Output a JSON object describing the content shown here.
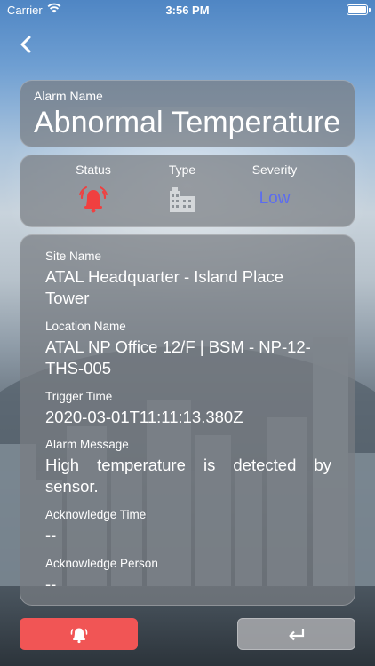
{
  "status_bar": {
    "carrier": "Carrier",
    "time": "3:56 PM"
  },
  "alarm_name": {
    "label": "Alarm Name",
    "value": "Abnormal Temperature"
  },
  "summary": {
    "status_label": "Status",
    "status_icon": "alarm-bell-icon",
    "type_label": "Type",
    "type_icon": "building-icon",
    "severity_label": "Severity",
    "severity_value": "Low",
    "severity_color": "#5b6cf0",
    "status_color": "#f04040"
  },
  "details": {
    "site_name_label": "Site Name",
    "site_name": "ATAL Headquarter - Island Place Tower",
    "location_label": "Location Name",
    "location": "ATAL NP Office 12/F | BSM - NP-12-THS-005",
    "trigger_time_label": "Trigger Time",
    "trigger_time": "2020-03-01T11:11:13.380Z",
    "message_label": "Alarm Message",
    "message": "High temperature is detected by sensor.",
    "ack_time_label": "Acknowledge Time",
    "ack_time": "--",
    "ack_person_label": "Acknowledge Person",
    "ack_person": "--"
  },
  "actions": {
    "alarm_icon": "alarm-bell-icon",
    "return_icon": "return-arrow-icon",
    "alarm_color": "#f15555"
  }
}
